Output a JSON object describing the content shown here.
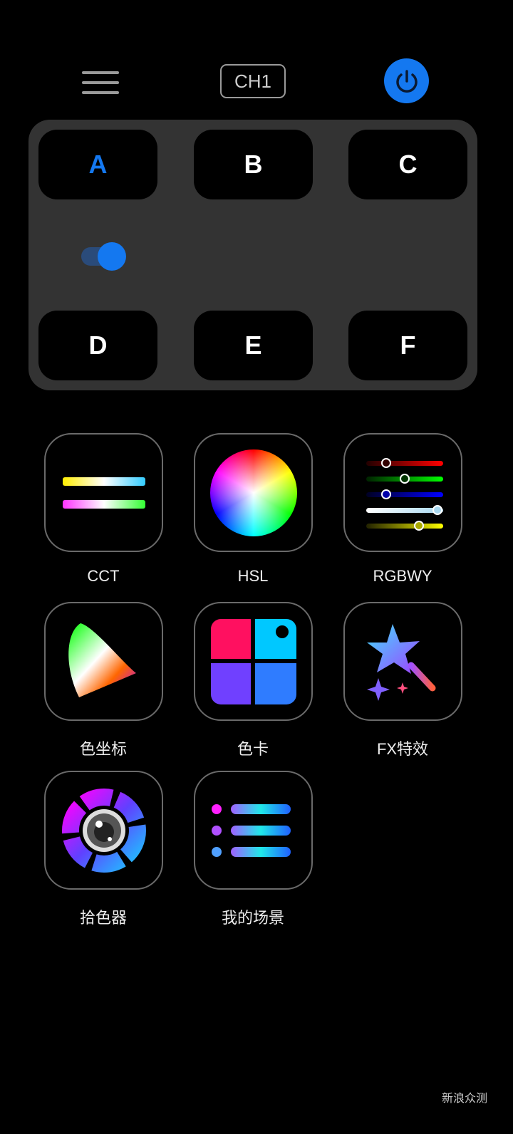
{
  "header": {
    "channel": "CH1",
    "menu_icon": "hamburger-menu-icon",
    "power_icon": "power-icon",
    "power_color": "#1478f0"
  },
  "groups": {
    "items": [
      "A",
      "B",
      "C",
      "D",
      "E",
      "F"
    ],
    "selected": "A",
    "accent": "#1478f0",
    "toggle_on": true
  },
  "functions": [
    {
      "label": "CCT",
      "icon": "cct-gradient-bars-icon"
    },
    {
      "label": "HSL",
      "icon": "color-wheel-icon"
    },
    {
      "label": "RGBWY",
      "icon": "rgbwy-sliders-icon"
    },
    {
      "label": "色坐标",
      "icon": "color-gamut-icon"
    },
    {
      "label": "色卡",
      "icon": "color-card-icon"
    },
    {
      "label": "FX特效",
      "icon": "magic-wand-star-icon"
    },
    {
      "label": "拾色器",
      "icon": "color-picker-camera-icon"
    },
    {
      "label": "我的场景",
      "icon": "scene-list-icon"
    }
  ],
  "watermark": "新浪众测"
}
